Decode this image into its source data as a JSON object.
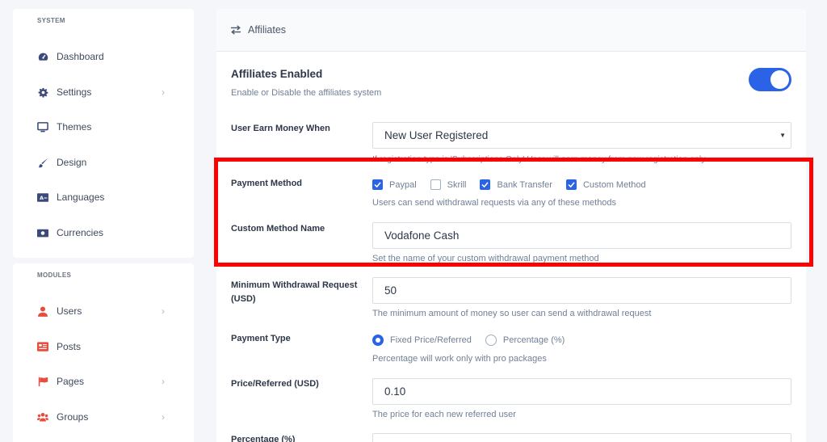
{
  "sidebar": {
    "system_title": "SYSTEM",
    "system_items": [
      {
        "label": "Dashboard",
        "icon": "dashboard-icon"
      },
      {
        "label": "Settings",
        "icon": "gear-icon"
      },
      {
        "label": "Themes",
        "icon": "monitor-icon"
      },
      {
        "label": "Design",
        "icon": "brush-icon"
      },
      {
        "label": "Languages",
        "icon": "language-icon"
      },
      {
        "label": "Currencies",
        "icon": "money-icon"
      }
    ],
    "modules_title": "MODULES",
    "module_items": [
      {
        "label": "Users",
        "icon": "user-icon"
      },
      {
        "label": "Posts",
        "icon": "posts-icon"
      },
      {
        "label": "Pages",
        "icon": "flag-icon"
      },
      {
        "label": "Groups",
        "icon": "users-icon"
      }
    ]
  },
  "main": {
    "header_title": "Affiliates",
    "affiliates_enabled": {
      "label": "Affiliates Enabled",
      "help": "Enable or Disable the affiliates system",
      "on": true
    },
    "earn_money": {
      "label": "User Earn Money When",
      "value": "New User Registered",
      "help": "If registration type is 'Subscriptions Only' User will earn money from new registration only"
    },
    "payment_method": {
      "label": "Payment Method",
      "options": [
        {
          "label": "Paypal",
          "checked": true
        },
        {
          "label": "Skrill",
          "checked": false
        },
        {
          "label": "Bank Transfer",
          "checked": true
        },
        {
          "label": "Custom Method",
          "checked": true
        }
      ],
      "help": "Users can send withdrawal requests via any of these methods"
    },
    "custom_method_name": {
      "label": "Custom Method Name",
      "value": "Vodafone Cash",
      "help": "Set the name of your custom withdrawal payment method"
    },
    "min_withdrawal": {
      "label_line1": "Minimum Withdrawal Request",
      "label_line2": "(USD)",
      "value": "50",
      "help": "The minimum amount of money so user can send a withdrawal request"
    },
    "payment_type": {
      "label": "Payment Type",
      "options": [
        {
          "label": "Fixed Price/Referred",
          "selected": true
        },
        {
          "label": "Percentage (%)",
          "selected": false
        }
      ],
      "help": "Percentage will work only with pro packages"
    },
    "price_referred": {
      "label": "Price/Referred (USD)",
      "value": "0.10",
      "help": "The price for each new referred user"
    },
    "percentage": {
      "label": "Percentage (%)"
    }
  },
  "colors": {
    "accent": "#2b63e6",
    "highlight": "#ff0000",
    "background": "#f4f6f9"
  }
}
